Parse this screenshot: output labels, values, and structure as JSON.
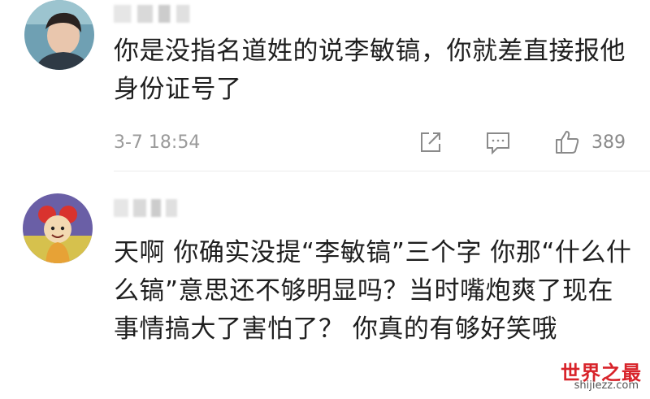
{
  "comments": [
    {
      "text": "你是没指名道姓的说李敏镐，你就差直接报他身份证号了",
      "timestamp": "3-7 18:54",
      "like_count": "389"
    },
    {
      "text": "天啊 你确实没提“李敏镐”三个字 你那“什么什么镐”意思还不够明显吗？当时嘴炮爽了现在事情搞大了害怕了？ 你真的有够好笑哦"
    }
  ],
  "icons": {
    "share": "share-icon",
    "comment": "comment-icon",
    "like": "thumbs-up-icon"
  },
  "colors": {
    "text": "#1f1f1f",
    "meta": "#9a9a9a",
    "watermark": "#d8232a"
  },
  "watermark": {
    "title": "世界之最",
    "url": "shijiezz.com"
  }
}
